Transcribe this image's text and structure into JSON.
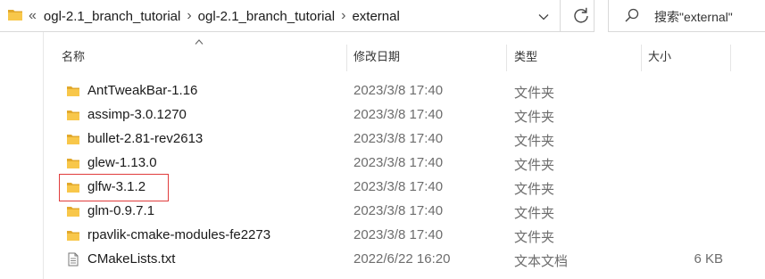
{
  "address_bar": {
    "overflow": "«",
    "crumbs": [
      "ogl-2.1_branch_tutorial",
      "ogl-2.1_branch_tutorial",
      "external"
    ],
    "separator": "›"
  },
  "search": {
    "placeholder": "搜索\"external\""
  },
  "columns": {
    "name": "名称",
    "date": "修改日期",
    "type": "类型",
    "size": "大小"
  },
  "files": [
    {
      "name": "AntTweakBar-1.16",
      "date": "2023/3/8 17:40",
      "type": "文件夹",
      "size": "",
      "kind": "folder-icon"
    },
    {
      "name": "assimp-3.0.1270",
      "date": "2023/3/8 17:40",
      "type": "文件夹",
      "size": "",
      "kind": "folder-icon"
    },
    {
      "name": "bullet-2.81-rev2613",
      "date": "2023/3/8 17:40",
      "type": "文件夹",
      "size": "",
      "kind": "folder-icon"
    },
    {
      "name": "glew-1.13.0",
      "date": "2023/3/8 17:40",
      "type": "文件夹",
      "size": "",
      "kind": "folder-icon"
    },
    {
      "name": "glfw-3.1.2",
      "date": "2023/3/8 17:40",
      "type": "文件夹",
      "size": "",
      "kind": "folder-icon"
    },
    {
      "name": "glm-0.9.7.1",
      "date": "2023/3/8 17:40",
      "type": "文件夹",
      "size": "",
      "kind": "folder-icon"
    },
    {
      "name": "rpavlik-cmake-modules-fe2273",
      "date": "2023/3/8 17:40",
      "type": "文件夹",
      "size": "",
      "kind": "folder-icon"
    },
    {
      "name": "CMakeLists.txt",
      "date": "2022/6/22 16:20",
      "type": "文本文档",
      "size": "6 KB",
      "kind": "text-file-icon"
    }
  ],
  "colors": {
    "folder": "#f8c74a",
    "folder_dark": "#e2a92c",
    "highlight_border": "#e03c3c"
  }
}
